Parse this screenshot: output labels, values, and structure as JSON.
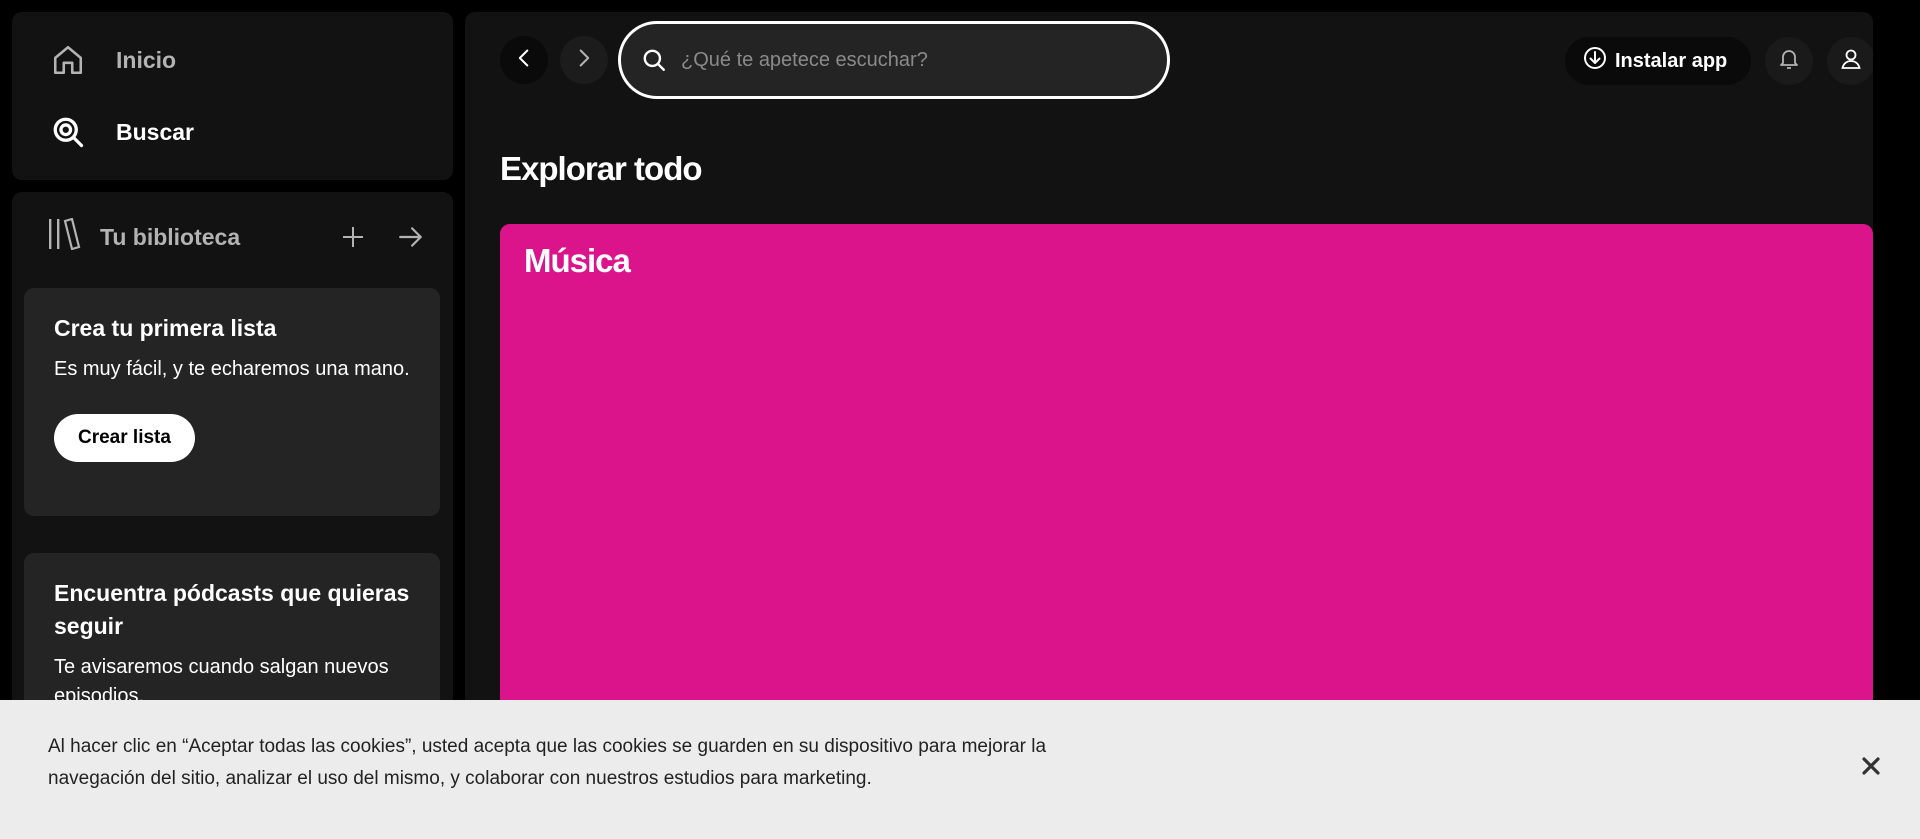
{
  "nav": {
    "home_label": "Inicio",
    "search_label": "Buscar"
  },
  "library": {
    "title": "Tu biblioteca",
    "cards": [
      {
        "title": "Crea tu primera lista",
        "text": "Es muy fácil, y te echaremos una mano.",
        "button": "Crear lista"
      },
      {
        "title": "Encuentra pódcasts que quieras seguir",
        "text": "Te avisaremos cuando salgan nuevos episodios."
      }
    ]
  },
  "topbar": {
    "search_placeholder": "¿Qué te apetece escuchar?",
    "install_label": "Instalar app"
  },
  "main": {
    "title": "Explorar todo",
    "genres": [
      {
        "label": "Música",
        "color": "#dc148c"
      }
    ]
  },
  "cookie": {
    "text": "Al hacer clic en “Aceptar todas las cookies”, usted acepta que las cookies se guarden en su dispositivo para mejorar la navegación del sitio, analizar el uso del mismo, y colaborar con nuestros estudios para marketing."
  },
  "colors": {
    "background": "#000000",
    "panel": "#121212",
    "card": "#242424",
    "accent_genre": "#dc148c",
    "cookie_bg": "#ececec"
  }
}
